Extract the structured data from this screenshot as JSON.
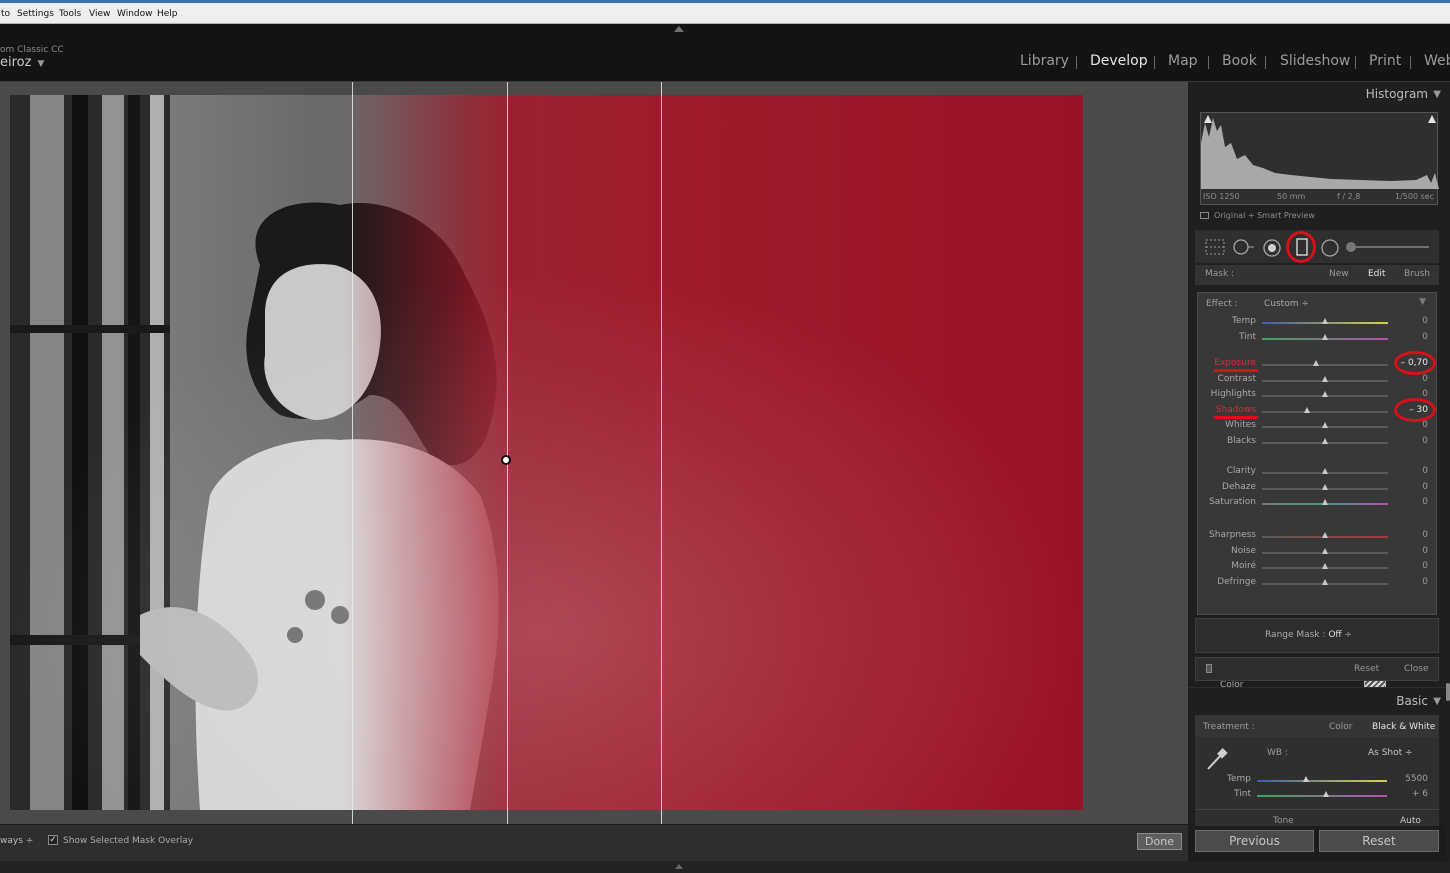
{
  "menubar": {
    "items": [
      "to",
      "Settings",
      "Tools",
      "View",
      "Window",
      "Help"
    ]
  },
  "identity": {
    "app_name": "om Classic CC",
    "user_name": "eiroz"
  },
  "modules": [
    {
      "label": "Library",
      "active": false
    },
    {
      "label": "Develop",
      "active": true
    },
    {
      "label": "Map",
      "active": false
    },
    {
      "label": "Book",
      "active": false
    },
    {
      "label": "Slideshow",
      "active": false
    },
    {
      "label": "Print",
      "active": false
    },
    {
      "label": "Web",
      "active": false
    }
  ],
  "colors": {
    "mask_overlay": "#a31528",
    "annotation_red": "#d8101a",
    "panel_bg": "#1f1f1f"
  },
  "histogram": {
    "title": "Histogram",
    "iso": "ISO 1250",
    "focal_length": "50 mm",
    "aperture": "f / 2,8",
    "shutter": "1/500 sec",
    "preview_label": "Original + Smart Preview"
  },
  "tools": [
    "crop-overlay-icon",
    "spot-removal-icon",
    "red-eye-icon",
    "graduated-filter-icon",
    "radial-filter-icon",
    "adjustment-brush-slider-icon"
  ],
  "mask": {
    "label": "Mask :",
    "new": "New",
    "edit": "Edit",
    "brush": "Brush"
  },
  "effect": {
    "label": "Effect :",
    "preset": "Custom",
    "groups": [
      [
        {
          "label": "Temp",
          "value": "0",
          "pos": 0.5
        },
        {
          "label": "Tint",
          "value": "0",
          "pos": 0.5
        }
      ],
      [
        {
          "label": "Exposure",
          "value": "– 0,70",
          "pos": 0.43
        },
        {
          "label": "Contrast",
          "value": "0",
          "pos": 0.5
        },
        {
          "label": "Highlights",
          "value": "0",
          "pos": 0.5
        },
        {
          "label": "Shadows",
          "value": "– 30",
          "pos": 0.36
        },
        {
          "label": "Whites",
          "value": "0",
          "pos": 0.5
        },
        {
          "label": "Blacks",
          "value": "0",
          "pos": 0.5
        }
      ],
      [
        {
          "label": "Clarity",
          "value": "0",
          "pos": 0.5
        },
        {
          "label": "Dehaze",
          "value": "0",
          "pos": 0.5
        },
        {
          "label": "Saturation",
          "value": "0",
          "pos": 0.5
        }
      ],
      [
        {
          "label": "Sharpness",
          "value": "0",
          "pos": 0.5
        },
        {
          "label": "Noise",
          "value": "0",
          "pos": 0.5
        },
        {
          "label": "Moiré",
          "value": "0",
          "pos": 0.5
        },
        {
          "label": "Defringe",
          "value": "0",
          "pos": 0.5
        }
      ]
    ],
    "color_label": "Color"
  },
  "range_mask": {
    "label": "Range Mask :",
    "value": "Off"
  },
  "reset_row": {
    "reset": "Reset",
    "close": "Close"
  },
  "basic": {
    "title": "Basic",
    "treatment_label": "Treatment :",
    "color": "Color",
    "bw": "Black & White",
    "wb_label": "WB :",
    "wb_value": "As Shot",
    "temp_label": "Temp",
    "temp_value": "5500",
    "temp_pos": 0.38,
    "tint_label": "Tint",
    "tint_value": "+ 6",
    "tint_pos": 0.53,
    "tone_label": "Tone",
    "auto": "Auto"
  },
  "footer": {
    "previous": "Previous",
    "reset": "Reset"
  },
  "toolbar": {
    "overlay_mode": "ways",
    "show_mask": "Show Selected Mask Overlay",
    "show_mask_checked": true,
    "done": "Done"
  }
}
